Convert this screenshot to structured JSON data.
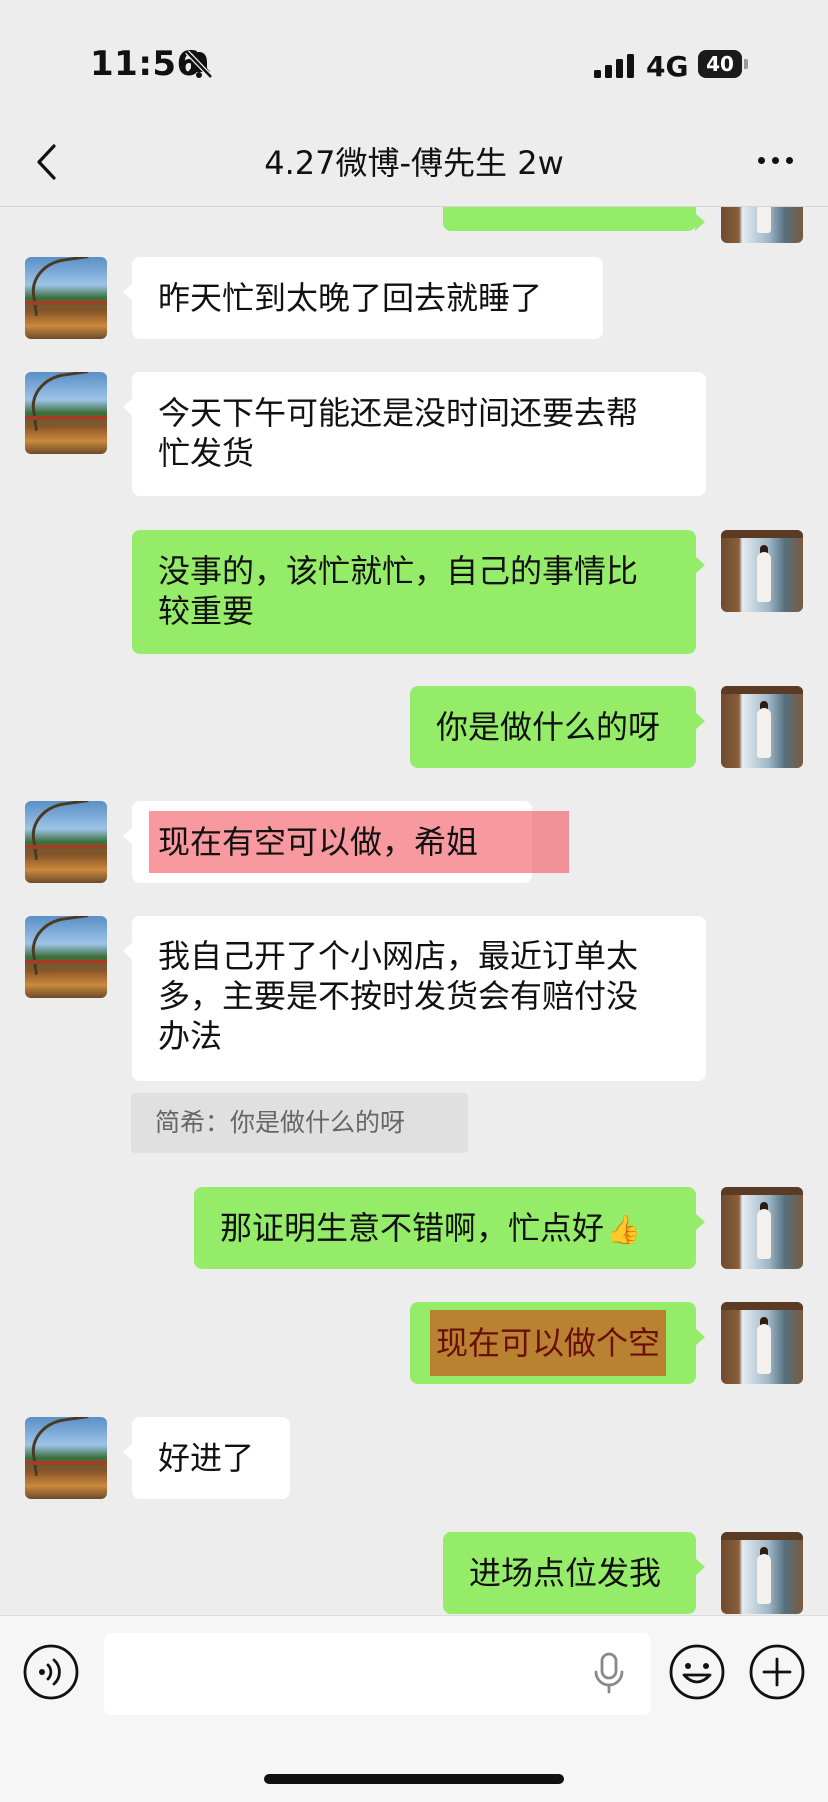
{
  "status_bar": {
    "time": "11:56",
    "network": "4G",
    "battery": "40",
    "icons": [
      "bell-muted-icon",
      "signal-icon",
      "battery-icon"
    ]
  },
  "nav": {
    "title": "4.27微博-傅先生 2w",
    "icons": [
      "back-icon",
      "more-icon"
    ]
  },
  "messages": [
    {
      "side": "left",
      "text": "昨天忙到太晚了回去就睡了"
    },
    {
      "side": "left",
      "lines": [
        "今天下午可能还是没时间还要去帮",
        "忙发货"
      ]
    },
    {
      "side": "right",
      "lines": [
        "没事的，该忙就忙，自己的事情比",
        "较重要"
      ]
    },
    {
      "side": "right",
      "text": "你是做什么的呀"
    },
    {
      "side": "left",
      "text": "现在有空可以做，希姐",
      "highlight": "#f45864"
    },
    {
      "side": "left",
      "lines": [
        "我自己开了个小网店，最近订单太",
        "多，主要是不按时发货会有赔付没",
        "办法"
      ],
      "quote": "简希：你是做什么的呀"
    },
    {
      "side": "right",
      "text": "那证明生意不错啊，忙点好",
      "emoji": "👍"
    },
    {
      "side": "right",
      "text": "现在可以做个空",
      "highlight": "#b88232"
    },
    {
      "side": "left",
      "text": "好进了"
    },
    {
      "side": "right",
      "text": "进场点位发我"
    }
  ],
  "input_bar": {
    "value": "",
    "icons": [
      "voice-icon",
      "mic-icon",
      "emoji-icon",
      "add-icon"
    ]
  },
  "colors": {
    "background": "#ededed",
    "bubble_self": "#95ec69",
    "bubble_other": "#ffffff"
  }
}
